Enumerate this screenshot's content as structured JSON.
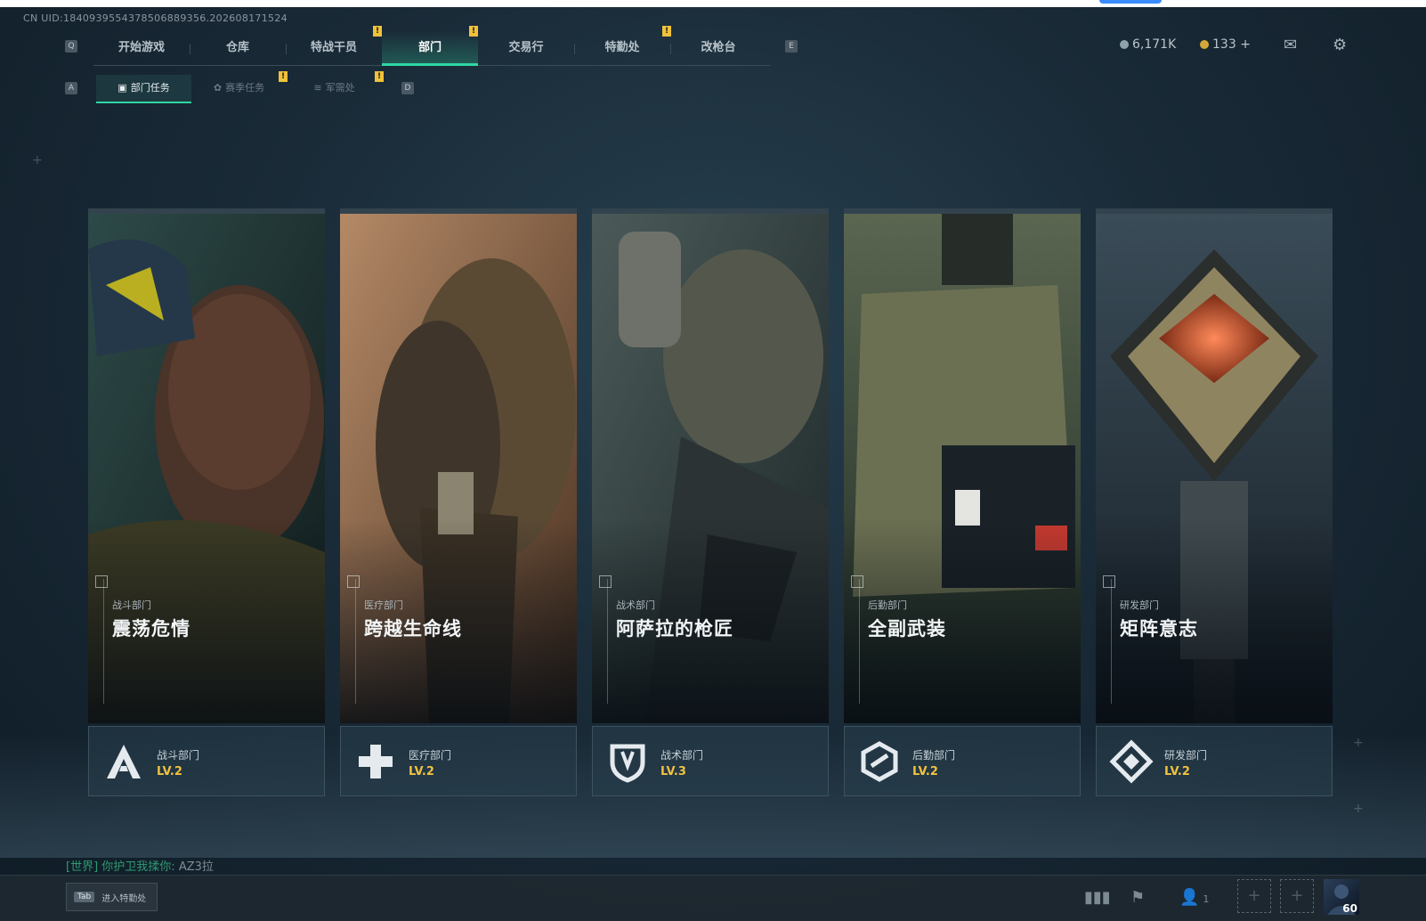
{
  "uid_text": "CN UID:1840939554378506889356.202608171524",
  "nav": {
    "key_left": "Q",
    "key_right": "E",
    "tabs": [
      "开始游戏",
      "仓库",
      "特战干员",
      "部门",
      "交易行",
      "特勤处",
      "改枪台"
    ],
    "active_index": 3,
    "alert_symbol": "!"
  },
  "subnav": {
    "key_left": "A",
    "key_right": "D",
    "tabs": [
      "部门任务",
      "赛季任务",
      "军需处"
    ],
    "active_index": 0
  },
  "currency": {
    "primary_value": "6,171K",
    "secondary_value": "133",
    "add_symbol": "+"
  },
  "cards": [
    {
      "dept_small": "战斗部门",
      "mission": "震荡危情",
      "dept_name": "战斗部门",
      "level": "LV.2",
      "emblem": "a-letter-icon"
    },
    {
      "dept_small": "医疗部门",
      "mission": "跨越生命线",
      "dept_name": "医疗部门",
      "level": "LV.2",
      "emblem": "medical-cross-icon"
    },
    {
      "dept_small": "战术部门",
      "mission": "阿萨拉的枪匠",
      "dept_name": "战术部门",
      "level": "LV.3",
      "emblem": "shield-icon"
    },
    {
      "dept_small": "后勤部门",
      "mission": "全副武装",
      "dept_name": "后勤部门",
      "level": "LV.2",
      "emblem": "hex-link-icon"
    },
    {
      "dept_small": "研发部门",
      "mission": "矩阵意志",
      "dept_name": "研发部门",
      "level": "LV.2",
      "emblem": "diamond-icon"
    }
  ],
  "chat": {
    "channel": "[世界]",
    "sender": "你护卫我揉你:",
    "message": "AZ3拉"
  },
  "bottom": {
    "tab_key": "Tab",
    "tab_label": "进入特勤处",
    "party_count": "1",
    "player_level": "60"
  },
  "colors": {
    "accent": "#2fd6a2",
    "alert": "#f0c23a",
    "level": "#f1c23d"
  }
}
